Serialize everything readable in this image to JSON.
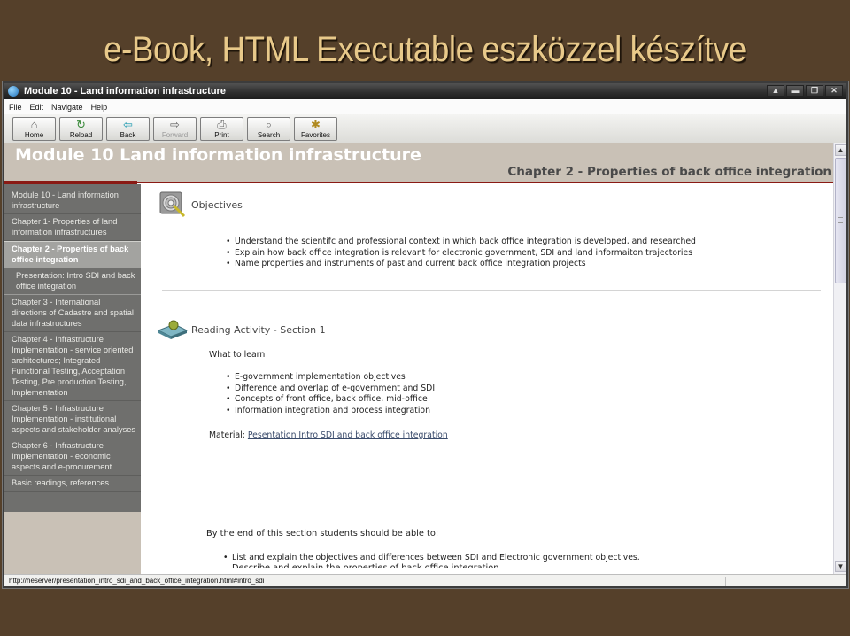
{
  "slide": {
    "title": "e-Book, HTML Executable eszközzel készítve"
  },
  "window": {
    "title": "Module 10 - Land information infrastructure",
    "controls": [
      {
        "name": "up",
        "glyph": "▲"
      },
      {
        "name": "minimize",
        "glyph": "▬"
      },
      {
        "name": "restore",
        "glyph": "❐"
      },
      {
        "name": "close",
        "glyph": "✕"
      }
    ]
  },
  "menu": {
    "items": [
      "File",
      "Edit",
      "Navigate",
      "Help"
    ]
  },
  "toolbar": {
    "buttons": [
      {
        "label": "Home",
        "icon": "home-icon",
        "glyph": "⌂",
        "enabled": true
      },
      {
        "label": "Reload",
        "icon": "reload-icon",
        "glyph": "↻",
        "enabled": true
      },
      {
        "label": "Back",
        "icon": "back-arrow-icon",
        "glyph": "⇦",
        "enabled": true
      },
      {
        "label": "Forward",
        "icon": "forward-arrow-icon",
        "glyph": "⇨",
        "enabled": false
      },
      {
        "label": "Print",
        "icon": "printer-icon",
        "glyph": "⎙",
        "enabled": true
      },
      {
        "label": "Search",
        "icon": "binoculars-icon",
        "glyph": "⌕",
        "enabled": true
      },
      {
        "label": "Favorites",
        "icon": "favorites-folder-icon",
        "glyph": "✱",
        "enabled": true
      }
    ]
  },
  "page": {
    "module_title": "Module 10 Land information infrastructure",
    "chapter_title": "Chapter 2 - Properties of back office integration"
  },
  "sidebar": {
    "items": [
      {
        "label": "Module 10 - Land information infrastructure",
        "active": false,
        "sub": false
      },
      {
        "label": "Chapter 1- Properties of land information infrastructures",
        "active": false,
        "sub": false
      },
      {
        "label": "Chapter 2 - Properties of back office integration",
        "active": true,
        "sub": false
      },
      {
        "label": "Presentation: Intro SDI and back office integration",
        "active": false,
        "sub": true
      },
      {
        "label": "Chapter 3 - International directions of Cadastre and spatial data infrastructures",
        "active": false,
        "sub": false
      },
      {
        "label": "Chapter 4 - Infrastructure Implementation - service oriented architectures; Integrated Functional Testing, Acceptation Testing, Pre production Testing, Implementation",
        "active": false,
        "sub": false
      },
      {
        "label": "Chapter 5 - Infrastructure Implementation - institutional aspects and stakeholder analyses",
        "active": false,
        "sub": false
      },
      {
        "label": "Chapter 6 - Infrastructure Implementation - economic aspects and e-procurement",
        "active": false,
        "sub": false
      },
      {
        "label": "Basic readings, references",
        "active": false,
        "sub": false
      }
    ]
  },
  "objectives": {
    "title": "Objectives",
    "items": [
      "Understand the scientifc and professional context in which back office integration is developed, and researched",
      "Explain how back office integration is relevant for electronic government, SDI and land informaiton trajectories",
      "Name properties and instruments of past and current back office integration projects"
    ]
  },
  "reading": {
    "title": "Reading Activity - Section 1",
    "what_to_learn": "What to learn",
    "items": [
      "E-government implementation objectives",
      "Difference and overlap of e-government and SDI",
      "Concepts of front office, back office, mid-office",
      "Information integration and process integration"
    ],
    "material_label": "Material:",
    "material_link": "Pesentation Intro SDI and back office integration",
    "end_text": "By the end of this section students should be able to:",
    "end_items": [
      "List and explain the objectives and differences between SDI and Electronic government objectives."
    ],
    "cut_off_line": "Describe and explain the properties of back office integration"
  },
  "statusbar": {
    "url": "http://heserver/presentation_intro_sdi_and_back_office_integration.html#intro_sdi"
  }
}
